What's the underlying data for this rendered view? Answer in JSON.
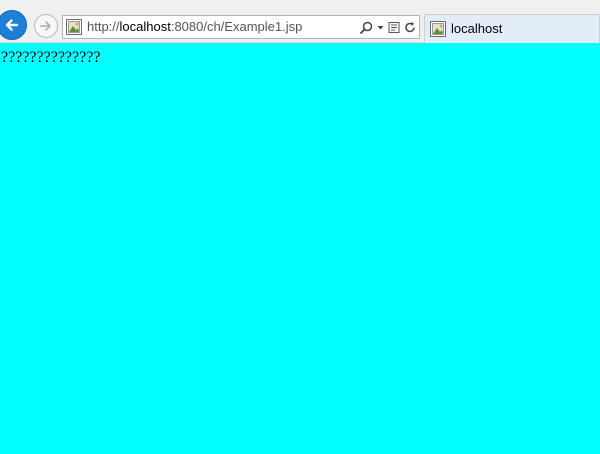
{
  "browser": {
    "address": {
      "scheme": "http://",
      "host": "localhost",
      "rest": ":8080/ch/Example1.jsp"
    },
    "tab": {
      "title": "localhost"
    },
    "icons": {
      "back": "back-arrow-icon",
      "forward": "forward-arrow-icon",
      "search": "search-icon",
      "dropdown": "dropdown-arrow-icon",
      "compat": "compatibility-view-icon",
      "refresh": "refresh-icon",
      "favicon": "page-favicon-icon"
    },
    "colors": {
      "back_button": "#1e7fd6",
      "toolbar": "#f0f0f0",
      "tab": "#e3edf7"
    }
  },
  "page": {
    "background": "#00ffff",
    "text": "??????????????"
  }
}
